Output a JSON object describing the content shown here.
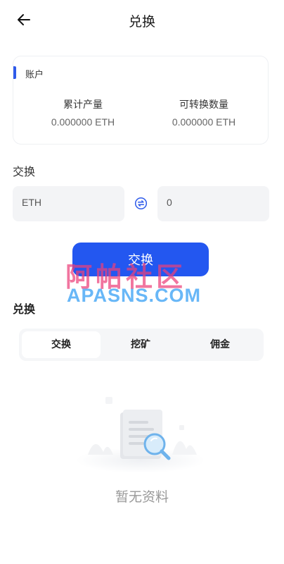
{
  "header": {
    "title": "兑换",
    "back_icon": "arrow-left-icon"
  },
  "account": {
    "title": "账户",
    "accent_color": "#2f5bea",
    "total_output_label": "累计产量",
    "total_output_value": "0.000000 ETH",
    "convertible_label": "可转换数量",
    "convertible_value": "0.000000 ETH"
  },
  "exchange": {
    "section_label": "交换",
    "from_value": "ETH",
    "to_value": "0",
    "swap_icon": "swap-arrows-icon",
    "button_label": "交换",
    "button_color": "#2357f0"
  },
  "watermark": {
    "chinese": "阿帕社区",
    "english": "APASNS.COM"
  },
  "history": {
    "title": "兑换",
    "tabs": [
      {
        "label": "交换",
        "active": true
      },
      {
        "label": "挖矿",
        "active": false
      },
      {
        "label": "佣金",
        "active": false
      }
    ],
    "empty_text": "暂无资料",
    "empty_icon": "document-search-icon"
  }
}
